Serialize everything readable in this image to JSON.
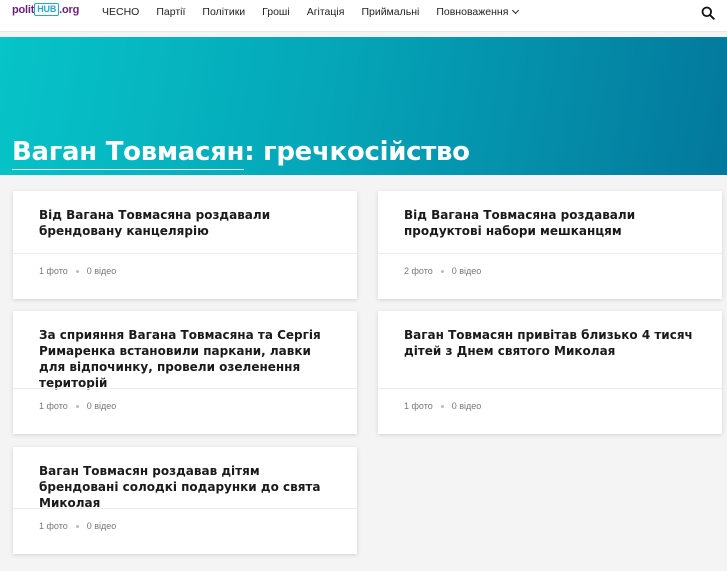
{
  "site": {
    "logo": {
      "part1": "polit",
      "part2": "HUB",
      "part3": ".org"
    }
  },
  "nav": {
    "items": [
      "ЧЕСНО",
      "Партії",
      "Політики",
      "Гроші",
      "Агітація",
      "Приймальні",
      "Повноваження"
    ]
  },
  "hero": {
    "name": "Ваган Товмасян",
    "suffix": ": гречкосійство",
    "colors": {
      "from": "#06c4c8",
      "to": "#03789c"
    }
  },
  "cards": [
    {
      "title": "Від Вагана Товмасяна роздавали брендовану канцелярію",
      "photos": "1 фото",
      "videos": "0 відео"
    },
    {
      "title": "Від Вагана Товмасяна роздавали продуктові набори мешканцям",
      "photos": "2 фото",
      "videos": "0 відео"
    },
    {
      "title": "За сприяння Вагана Товмасяна та Сергія Римаренка встановили паркани, лавки для відпочинку, провели озеленення територій",
      "photos": "1 фото",
      "videos": "0 відео"
    },
    {
      "title": "Ваган Товмасян привітав близько 4 тисяч дітей з Днем святого Миколая",
      "photos": "1 фото",
      "videos": "0 відео"
    },
    {
      "title": "Ваган Товмасян роздавав дітям брендовані солодкі подарунки до свята Миколая",
      "photos": "1 фото",
      "videos": "0 відео"
    }
  ],
  "icons": {
    "search": "search-icon",
    "dropdown": "chevron-down-icon"
  }
}
